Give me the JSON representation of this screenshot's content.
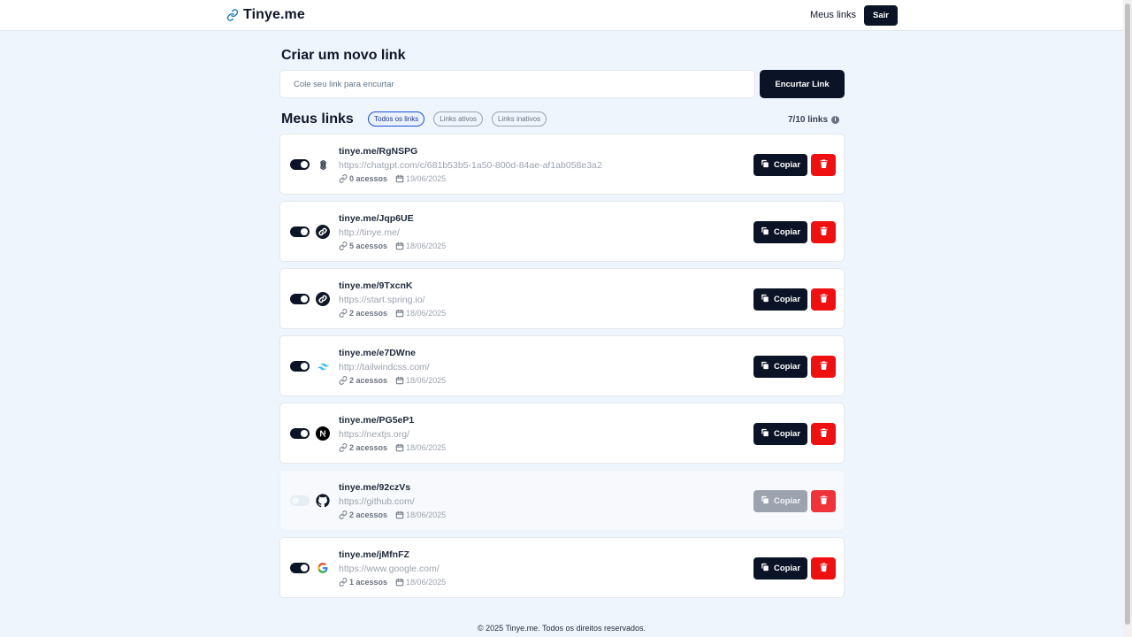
{
  "header": {
    "brand": "Tinye.me",
    "nav_link": "Meus links",
    "logout": "Sair"
  },
  "create": {
    "title": "Criar um novo link",
    "placeholder": "Cole seu link para encurtar",
    "button": "Encurtar Link"
  },
  "list": {
    "title": "Meus links",
    "filters": [
      "Todos os links",
      "Links ativos",
      "Links inativos"
    ],
    "active_filter": "Todos os links",
    "quota": "7/10 links"
  },
  "links": [
    {
      "short": "tinye.me/RgNSPG",
      "url": "https://chatgpt.com/c/681b53b5-1a50-800d-84ae-af1ab058e3a2",
      "clicks": "0 acessos",
      "date": "19/06/2025",
      "active": true,
      "icon": "openai-icon",
      "copy": "Copiar"
    },
    {
      "short": "tinye.me/Jqp6UE",
      "url": "http://tinye.me/",
      "clicks": "5 acessos",
      "date": "18/06/2025",
      "active": true,
      "icon": "link-icon",
      "copy": "Copiar"
    },
    {
      "short": "tinye.me/9TxcnK",
      "url": "https://start.spring.io/",
      "clicks": "2 acessos",
      "date": "18/06/2025",
      "active": true,
      "icon": "link-icon",
      "copy": "Copiar"
    },
    {
      "short": "tinye.me/e7DWne",
      "url": "http://tailwindcss.com/",
      "clicks": "2 acessos",
      "date": "18/06/2025",
      "active": true,
      "icon": "tailwind-icon",
      "copy": "Copiar"
    },
    {
      "short": "tinye.me/PG5eP1",
      "url": "https://nextjs.org/",
      "clicks": "2 acessos",
      "date": "18/06/2025",
      "active": true,
      "icon": "nextjs-icon",
      "copy": "Copiar"
    },
    {
      "short": "tinye.me/92czVs",
      "url": "https://github.com/",
      "clicks": "2 acessos",
      "date": "18/06/2025",
      "active": false,
      "icon": "github-icon",
      "copy": "Copiar"
    },
    {
      "short": "tinye.me/jMfnFZ",
      "url": "https://www.google.com/",
      "clicks": "1 acessos",
      "date": "18/06/2025",
      "active": true,
      "icon": "google-icon",
      "copy": "Copiar"
    }
  ],
  "footer": "© 2025 Tinye.me. Todos os direitos reservados.",
  "colors": {
    "background": "#eef5fd",
    "primary": "#0b1426",
    "danger": "#ef1111",
    "accent": "#1d4ed8"
  }
}
